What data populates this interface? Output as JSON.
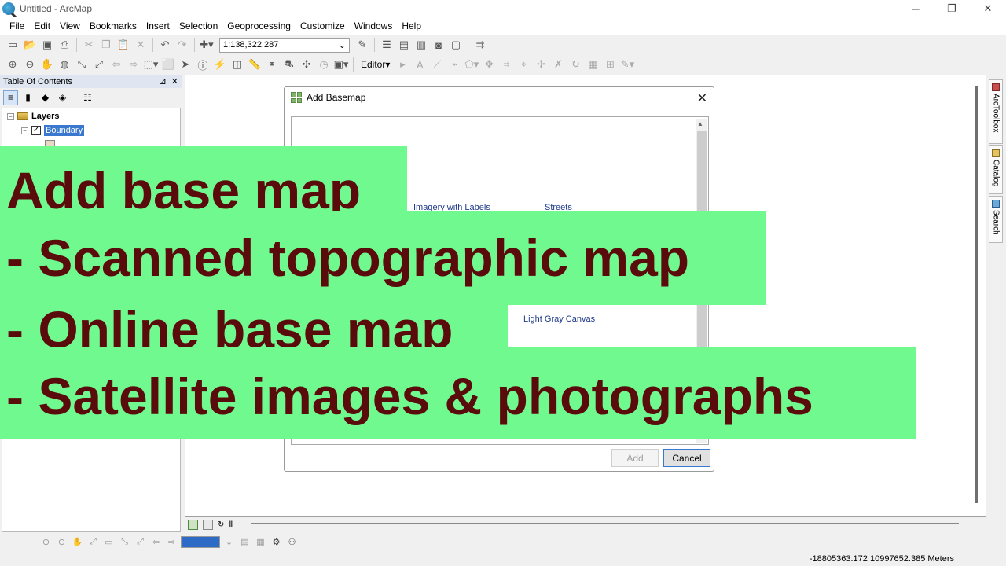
{
  "window": {
    "title": "Untitled - ArcMap",
    "minimize": "─",
    "restore": "❐",
    "close": "✕"
  },
  "menu": [
    "File",
    "Edit",
    "View",
    "Bookmarks",
    "Insert",
    "Selection",
    "Geoprocessing",
    "Customize",
    "Windows",
    "Help"
  ],
  "toolbar": {
    "scale_value": "1:138,322,287",
    "editor_label": "Editor"
  },
  "toc": {
    "title": "Table Of Contents",
    "pin": "⊿",
    "close": "✕",
    "group_label": "Layers",
    "layer_label": "Boundary"
  },
  "dock": {
    "arctoolbox": "ArcToolbox",
    "catalog": "Catalog",
    "search": "Search"
  },
  "dialog": {
    "title": "Add Basemap",
    "close": "✕",
    "basemaps": {
      "imagery_labels": "Imagery with Labels",
      "streets": "Streets",
      "light_gray": "Light Gray Canvas"
    },
    "add_label": "Add",
    "cancel_label": "Cancel"
  },
  "status": {
    "coordinates": "-18805363.172  10997652.385 Meters"
  },
  "overlay": {
    "line1": "Add base map",
    "line2": "- Scanned topographic map",
    "line3": "- Online base map",
    "line4": "- Satellite images & photographs"
  },
  "colors": {
    "banner_bg": "#6ff98f",
    "banner_text": "#5a0b0b",
    "selection": "#3a78d0"
  }
}
